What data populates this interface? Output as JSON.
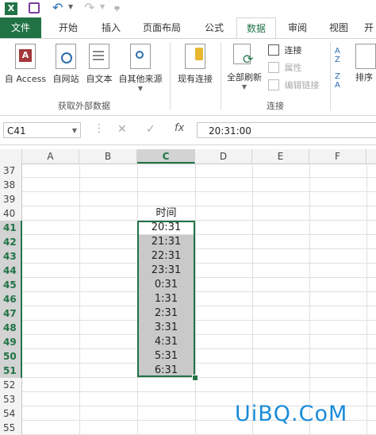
{
  "titlebar": {
    "undo_icon": "undo-icon",
    "redo_icon": "redo-icon"
  },
  "tabs": [
    "文件",
    "开始",
    "插入",
    "页面布局",
    "公式",
    "数据",
    "审阅",
    "视图",
    "开"
  ],
  "active_tab": "数据",
  "ribbon": {
    "get_external": {
      "buttons": [
        "自 Access",
        "自网站",
        "自文本",
        "自其他来源"
      ],
      "label": "获取外部数据"
    },
    "existing_connections": "现有连接",
    "refresh_all": "全部刷新",
    "connections": {
      "items": [
        "连接",
        "属性",
        "编辑链接"
      ],
      "label": "连接"
    },
    "sort_label": "排序",
    "sort_az_az": "A\nZ",
    "sort_za": "Z\nA"
  },
  "formula_bar": {
    "name_box": "C41",
    "fx": "fx",
    "cancel": "✕",
    "confirm": "✓",
    "content": "20:31:00"
  },
  "columns": [
    "A",
    "B",
    "C",
    "D",
    "E",
    "F"
  ],
  "selected_column": "C",
  "rows": [
    {
      "num": "37",
      "c": "",
      "sel": false
    },
    {
      "num": "38",
      "c": "",
      "sel": false
    },
    {
      "num": "39",
      "c": "",
      "sel": false
    },
    {
      "num": "40",
      "c": "时间",
      "sel": false
    },
    {
      "num": "41",
      "c": "20:31",
      "sel": true
    },
    {
      "num": "42",
      "c": "21:31",
      "sel": true
    },
    {
      "num": "43",
      "c": "22:31",
      "sel": true
    },
    {
      "num": "44",
      "c": "23:31",
      "sel": true
    },
    {
      "num": "45",
      "c": "0:31",
      "sel": true
    },
    {
      "num": "46",
      "c": "1:31",
      "sel": true
    },
    {
      "num": "47",
      "c": "2:31",
      "sel": true
    },
    {
      "num": "48",
      "c": "3:31",
      "sel": true
    },
    {
      "num": "49",
      "c": "4:31",
      "sel": true
    },
    {
      "num": "50",
      "c": "5:31",
      "sel": true
    },
    {
      "num": "51",
      "c": "6:31",
      "sel": true
    },
    {
      "num": "52",
      "c": "",
      "sel": false
    },
    {
      "num": "53",
      "c": "",
      "sel": false
    },
    {
      "num": "54",
      "c": "",
      "sel": false
    },
    {
      "num": "55",
      "c": "",
      "sel": false
    }
  ],
  "watermark": "UiBQ.CoM",
  "colors": {
    "accent": "#217346",
    "watermark": "#1a8bd8",
    "highlight": "#c9c9c9"
  }
}
